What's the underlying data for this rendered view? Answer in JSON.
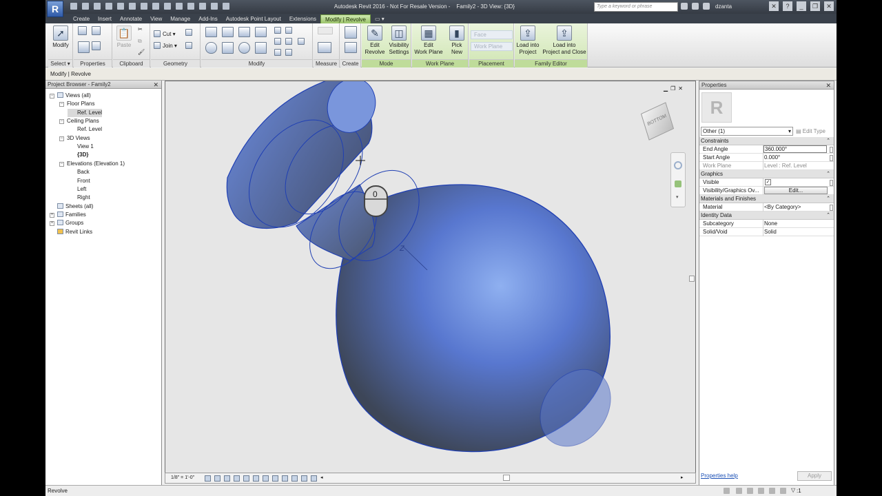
{
  "titlebar": {
    "app_logo": "R",
    "title": "Autodesk Revit 2016 - Not For Resale Version -    Family2 - 3D View: {3D}",
    "search_placeholder": "Type a keyword or phrase",
    "user": "dzanta",
    "help": "?"
  },
  "tabs": [
    "Create",
    "Insert",
    "Annotate",
    "View",
    "Manage",
    "Add-Ins",
    "Autodesk Point Layout",
    "Extensions",
    "Modify | Revolve"
  ],
  "ribbon": {
    "select": {
      "modify": "Modify",
      "select": "Select ▾"
    },
    "properties_label": "Properties",
    "clipboard": {
      "paste": "Paste",
      "label": "Clipboard"
    },
    "geometry": {
      "cut": "Cut ▾",
      "join": "Join ▾",
      "label": "Geometry"
    },
    "modify_label": "Modify",
    "measure_label": "Measure",
    "create_label": "Create",
    "mode": {
      "edit_revolve": "Edit\nRevolve",
      "visibility_settings": "Visibility\nSettings",
      "label": "Mode"
    },
    "work_plane": {
      "edit_work_plane": "Edit\nWork Plane",
      "pick_new": "Pick\nNew",
      "label": "Work Plane"
    },
    "placement": {
      "face": "Face",
      "work_plane": "Work Plane",
      "label": "Placement"
    },
    "family_editor": {
      "load_into_project": "Load into\nProject",
      "load_into_project_close": "Load into\nProject and Close",
      "label": "Family Editor"
    }
  },
  "options_bar": {
    "context": "Modify | Revolve"
  },
  "project_browser": {
    "title": "Project Browser - Family2",
    "tree": [
      {
        "label": "Views (all)",
        "toggle": "−"
      },
      {
        "label": "Floor Plans",
        "toggle": "−"
      },
      {
        "label": "Ref. Level"
      },
      {
        "label": "Ceiling Plans",
        "toggle": "−"
      },
      {
        "label": "Ref. Level"
      },
      {
        "label": "3D Views",
        "toggle": "−"
      },
      {
        "label": "View 1"
      },
      {
        "label": "{3D}"
      },
      {
        "label": "Elevations (Elevation 1)",
        "toggle": "−"
      },
      {
        "label": "Back"
      },
      {
        "label": "Front"
      },
      {
        "label": "Left"
      },
      {
        "label": "Right"
      },
      {
        "label": "Sheets (all)"
      },
      {
        "label": "Families",
        "toggle": "+"
      },
      {
        "label": "Groups",
        "toggle": "+"
      },
      {
        "label": "Revit Links"
      }
    ]
  },
  "viewport": {
    "viewcube_face": "BOTTOM",
    "scale": "1/8\" = 1'-0\"",
    "colors": {
      "solid": "#5e7ed8",
      "edge": "#1f3fb3",
      "background": "#e6e6e6"
    }
  },
  "properties": {
    "title": "Properties",
    "type_selector": "Other (1)",
    "edit_type": "Edit Type",
    "sections": {
      "constraints": "Constraints",
      "graphics": "Graphics",
      "materials": "Materials and Finishes",
      "identity": "Identity Data"
    },
    "rows": {
      "end_angle": {
        "label": "End Angle",
        "value": "360.000°"
      },
      "start_angle": {
        "label": "Start Angle",
        "value": "0.000°"
      },
      "work_plane": {
        "label": "Work Plane",
        "value": "Level : Ref. Level"
      },
      "visible": {
        "label": "Visible",
        "value": "✓"
      },
      "vg_overrides": {
        "label": "Visibility/Graphics Ov...",
        "value": "Edit..."
      },
      "material": {
        "label": "Material",
        "value": "<By Category>"
      },
      "subcategory": {
        "label": "Subcategory",
        "value": "None"
      },
      "solid_void": {
        "label": "Solid/Void",
        "value": "Solid"
      }
    },
    "help_link": "Properties help",
    "apply": "Apply"
  },
  "status": {
    "text": "Revolve",
    "filter_count": ":1"
  }
}
